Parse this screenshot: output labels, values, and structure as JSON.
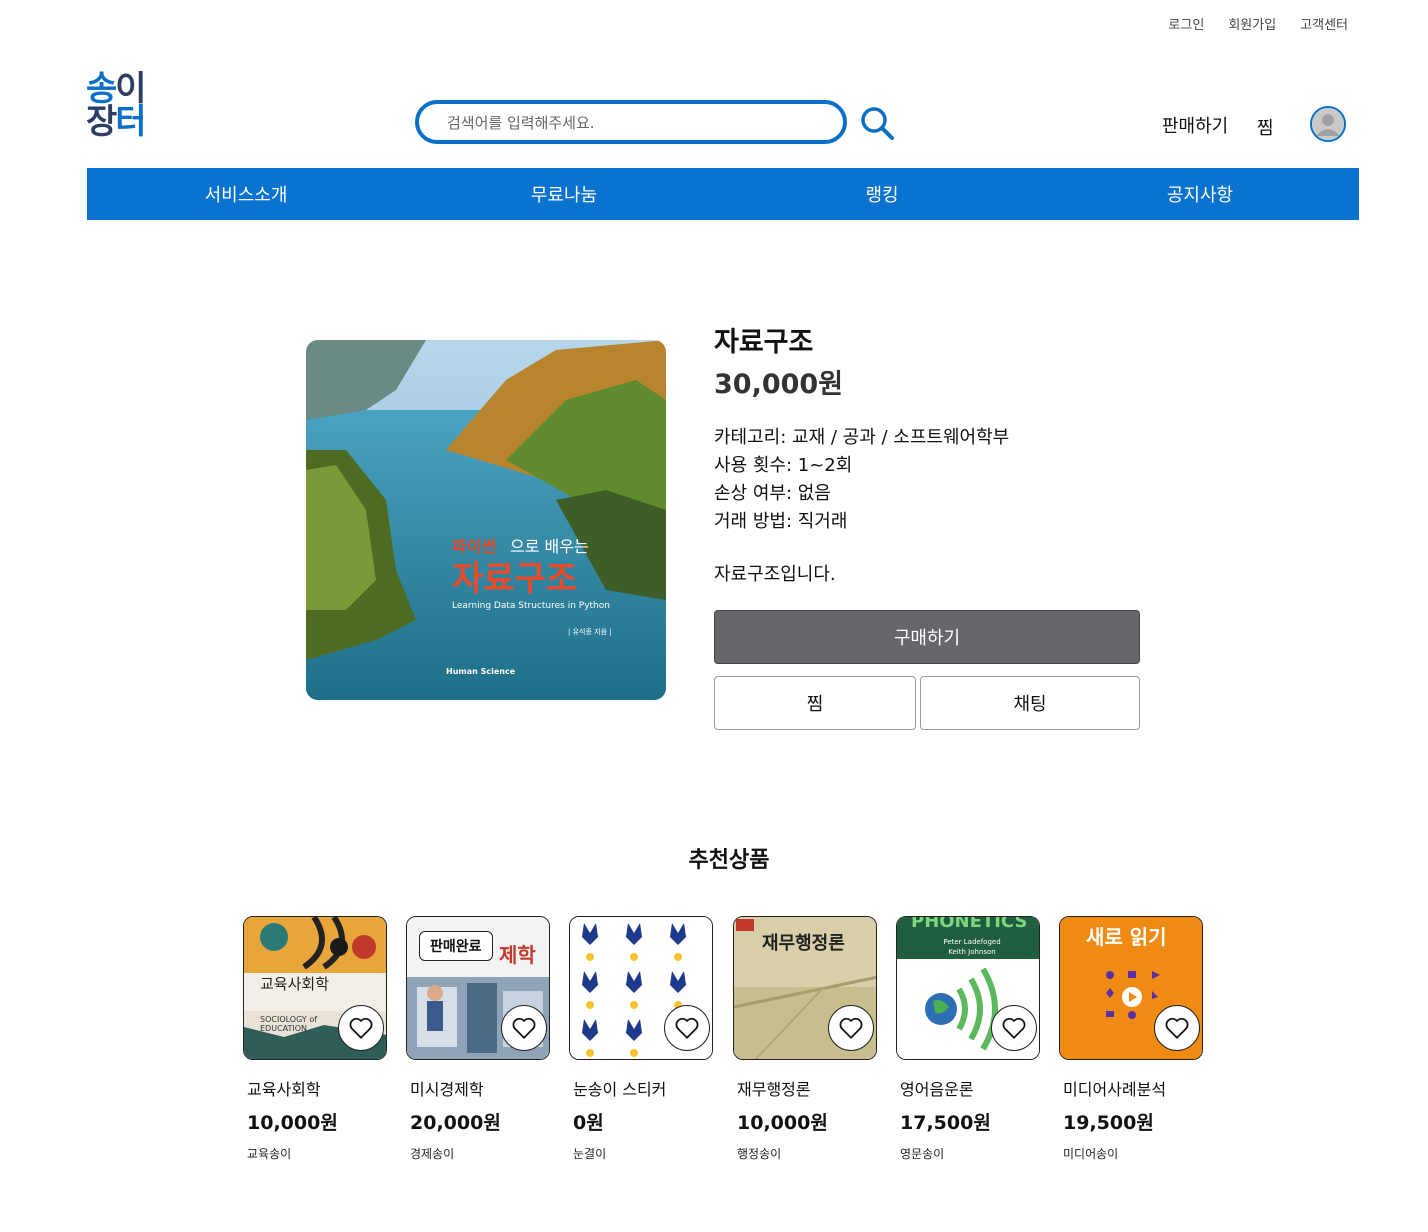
{
  "util_links": [
    "로그인",
    "회원가입",
    "고객센터"
  ],
  "logo": {
    "line1a": "송",
    "line1b": "이",
    "line2a": "장",
    "line2b": "터"
  },
  "search": {
    "placeholder": "검색어를 입력해주세요."
  },
  "header": {
    "sell_label": "판매하기",
    "wish_label": "찜"
  },
  "nav": [
    "서비스소개",
    "무료나눔",
    "랭킹",
    "공지사항"
  ],
  "product": {
    "title": "자료구조",
    "price": "30,000원",
    "category": "카테고리: 교재 / 공과 / 소프트웨어학부",
    "usage": "사용 횟수: 1~2회",
    "damage": "손상 여부: 없음",
    "method": "거래 방법: 직거래",
    "description": "자료구조입니다.",
    "buy_label": "구매하기",
    "wish_label": "찜",
    "chat_label": "채팅",
    "cover": {
      "title_line1a": "파이썬",
      "title_line1b": "으로 배우는",
      "title_main": "자료구조",
      "subtitle": "Learning Data Structures in Python",
      "author": "| 유석종 지음 |",
      "publisher": "Human Science"
    }
  },
  "recommend": {
    "title": "추천상품",
    "sold_label": "판매완료",
    "items": [
      {
        "name": "교육사회학",
        "price": "10,000원",
        "seller": "교육송이",
        "cover_text": "교육사회학",
        "cover_sub": "SOCIOLOGY of EDUCATION"
      },
      {
        "name": "미시경제학",
        "price": "20,000원",
        "seller": "경제송이",
        "cover_text": "제학"
      },
      {
        "name": "눈송이 스티커",
        "price": "0원",
        "seller": "눈결이"
      },
      {
        "name": "재무행정론",
        "price": "10,000원",
        "seller": "행정송이",
        "cover_text": "재무행정론"
      },
      {
        "name": "영어음운론",
        "price": "17,500원",
        "seller": "영문송이",
        "cover_text": "PHONETICS",
        "cover_sub": "Peter Ladefoged Keith Johnson"
      },
      {
        "name": "미디어사례분석",
        "price": "19,500원",
        "seller": "미디어송이",
        "cover_text": "새로 읽기"
      }
    ]
  }
}
